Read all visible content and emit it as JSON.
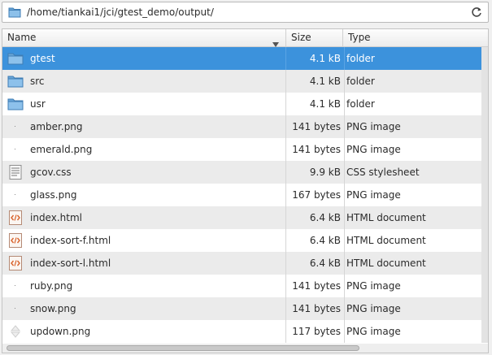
{
  "path_bar": {
    "path": "/home/tiankai1/jci/gtest_demo/output/",
    "folder_icon": "folder-icon",
    "reload_icon": "reload-icon"
  },
  "columns": {
    "name": "Name",
    "size": "Size",
    "type": "Type"
  },
  "files": [
    {
      "name": "gtest",
      "size": "4.1 kB",
      "type": "folder",
      "icon": "folder-icon",
      "selected": true
    },
    {
      "name": "src",
      "size": "4.1 kB",
      "type": "folder",
      "icon": "folder-icon"
    },
    {
      "name": "usr",
      "size": "4.1 kB",
      "type": "folder",
      "icon": "folder-icon"
    },
    {
      "name": "amber.png",
      "size": "141 bytes",
      "type": "PNG image",
      "icon": "image-thumbnail-icon"
    },
    {
      "name": "emerald.png",
      "size": "141 bytes",
      "type": "PNG image",
      "icon": "image-thumbnail-icon"
    },
    {
      "name": "gcov.css",
      "size": "9.9 kB",
      "type": "CSS stylesheet",
      "icon": "text-file-icon"
    },
    {
      "name": "glass.png",
      "size": "167 bytes",
      "type": "PNG image",
      "icon": "image-thumbnail-icon"
    },
    {
      "name": "index.html",
      "size": "6.4 kB",
      "type": "HTML document",
      "icon": "html-file-icon"
    },
    {
      "name": "index-sort-f.html",
      "size": "6.4 kB",
      "type": "HTML document",
      "icon": "html-file-icon"
    },
    {
      "name": "index-sort-l.html",
      "size": "6.4 kB",
      "type": "HTML document",
      "icon": "html-file-icon"
    },
    {
      "name": "ruby.png",
      "size": "141 bytes",
      "type": "PNG image",
      "icon": "image-thumbnail-icon"
    },
    {
      "name": "snow.png",
      "size": "141 bytes",
      "type": "PNG image",
      "icon": "image-thumbnail-icon"
    },
    {
      "name": "updown.png",
      "size": "117 bytes",
      "type": "PNG image",
      "icon": "updown-thumbnail-icon"
    }
  ],
  "colors": {
    "selection": "#3c92dc",
    "row_alt": "#ebebeb"
  }
}
